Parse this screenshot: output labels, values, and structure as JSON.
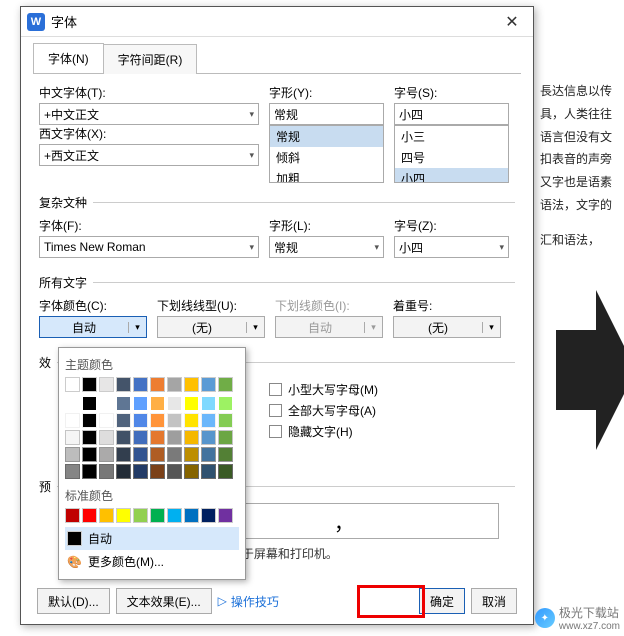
{
  "dialog": {
    "title": "字体",
    "close": "✕",
    "tabs": {
      "font": "字体(N)",
      "spacing": "字符间距(R)"
    }
  },
  "top": {
    "cn_font_lbl": "中文字体(T):",
    "cn_font_val": "+中文正文",
    "style_lbl": "字形(Y):",
    "style_val": "常规",
    "size_lbl": "字号(S):",
    "size_val": "小四",
    "style_list": {
      "a": "常规",
      "b": "倾斜",
      "c": "加粗"
    },
    "size_list": {
      "a": "小三",
      "b": "四号",
      "c": "小四"
    },
    "en_font_lbl": "西文字体(X):",
    "en_font_val": "+西文正文"
  },
  "complex": {
    "legend": "复杂文种",
    "font_lbl": "字体(F):",
    "font_val": "Times New Roman",
    "style_lbl": "字形(L):",
    "style_val": "常规",
    "size_lbl": "字号(Z):",
    "size_val": "小四"
  },
  "all": {
    "legend": "所有文字",
    "color_lbl": "字体颜色(C):",
    "color_val": "自动",
    "underline_lbl": "下划线线型(U):",
    "underline_val": "(无)",
    "ucolor_lbl": "下划线颜色(I):",
    "ucolor_val": "自动",
    "emph_lbl": "着重号:",
    "emph_val": "(无)"
  },
  "effects": {
    "legend": "效",
    "smallcaps": "小型大写字母(M)",
    "allcaps": "全部大写字母(A)",
    "hidden": "隐藏文字(H)"
  },
  "popup": {
    "theme_lbl": "主题颜色",
    "std_lbl": "标准颜色",
    "auto": "自动",
    "more": "更多颜色(M)..."
  },
  "preview": {
    "legend": "预",
    "comma": "，"
  },
  "tip": "此 TrueType 子体，同时适用于屏幕和打印机。",
  "footer": {
    "default": "默认(D)...",
    "texteffect": "文本效果(E)...",
    "help": "操作技巧",
    "ok": "确定",
    "cancel": "取消"
  },
  "bg": {
    "l1": "長达信息以传",
    "l2": "具，人类往往",
    "l3": "语言但没有文",
    "l4": "扣表音的声旁",
    "l5": "又字也是语素",
    "l6": "语法，文字的",
    "l7": "汇和语法，"
  },
  "watermark": {
    "site": "极光下载站",
    "url": "www.xz7.com"
  }
}
